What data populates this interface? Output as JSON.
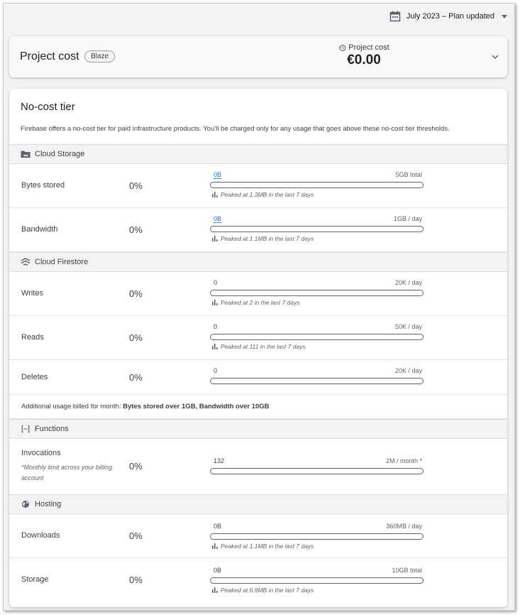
{
  "header": {
    "period_label": "July 2023 – Plan updated"
  },
  "cost": {
    "title": "Project cost",
    "plan_badge": "Blaze",
    "label": "Project cost",
    "value": "€0.00"
  },
  "tier": {
    "title": "No-cost tier",
    "description": "Firebase offers a no-cost tier for paid infrastructure products. You'll be charged only for any usage that goes above these no-cost tier thresholds."
  },
  "sections": {
    "storage": {
      "name": "Cloud Storage"
    },
    "firestore": {
      "name": "Cloud Firestore"
    },
    "functions": {
      "name": "Functions"
    },
    "hosting": {
      "name": "Hosting"
    }
  },
  "rows": {
    "bytes_stored": {
      "label": "Bytes stored",
      "percent": "0%",
      "current": "0B",
      "max": "5GB total",
      "peak": "Peaked at 1.3MB in the last 7 days",
      "fill": 0
    },
    "bandwidth": {
      "label": "Bandwidth",
      "percent": "0%",
      "current": "0B",
      "max": "1GB / day",
      "peak": "Peaked at 1.1MB in the last 7 days",
      "fill": 0
    },
    "writes": {
      "label": "Writes",
      "percent": "0%",
      "current": "0",
      "max": "20K / day",
      "peak": "Peaked at 2 in the last 7 days",
      "fill": 0
    },
    "reads": {
      "label": "Reads",
      "percent": "0%",
      "current": "0",
      "max": "50K / day",
      "peak": "Peaked at 111 in the last 7 days",
      "fill": 0
    },
    "deletes": {
      "label": "Deletes",
      "percent": "0%",
      "current": "0",
      "max": "20K / day",
      "fill": 0
    },
    "invocations": {
      "label": "Invocations",
      "note": "*Monthly limit across your billing account",
      "percent": "0%",
      "current": "132",
      "max": "2M / month *",
      "fill": 0
    },
    "downloads": {
      "label": "Downloads",
      "percent": "0%",
      "current": "0B",
      "max": "360MB / day",
      "peak": "Peaked at 1.1MB in the last 7 days",
      "fill": 0
    },
    "hosting_storage": {
      "label": "Storage",
      "percent": "0%",
      "current": "0B",
      "max": "10GB total",
      "peak": "Peaked at 6.9MB in the last 7 days",
      "fill": 0
    }
  },
  "billed": {
    "prefix": "Additional usage billed for month:",
    "detail": "Bytes stored over 1GB, Bandwidth over 10GB"
  },
  "colors": {
    "accent": "#1a73e8",
    "section_bg": "#f1f3f4",
    "card_bg": "#f8f9fa"
  }
}
